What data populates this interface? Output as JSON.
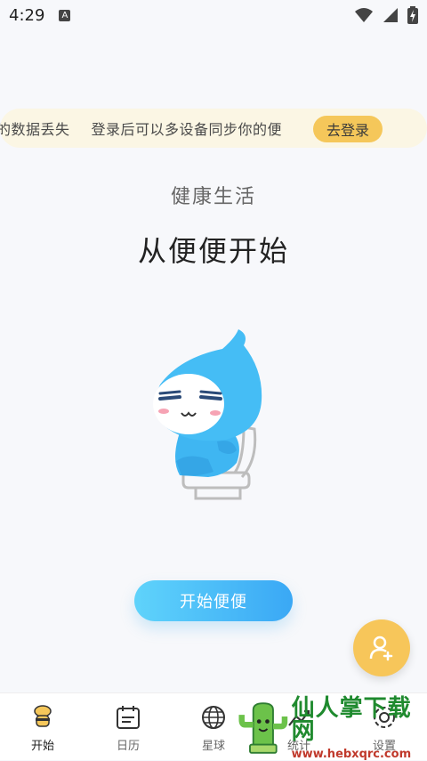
{
  "status_bar": {
    "time": "4:29",
    "badge": "A"
  },
  "banner": {
    "marquee_text_1": "的数据丢失",
    "marquee_text_2": "登录后可以多设备同步你的便",
    "login_label": "去登录"
  },
  "main": {
    "subtitle": "健康生活",
    "title": "从便便开始",
    "start_label": "开始便便"
  },
  "tabs": [
    {
      "label": "开始",
      "icon": "toilet-icon",
      "active": true
    },
    {
      "label": "日历",
      "icon": "calendar-icon",
      "active": false
    },
    {
      "label": "星球",
      "icon": "globe-icon",
      "active": false
    },
    {
      "label": "",
      "icon": "download-icon",
      "active": false
    },
    {
      "label": "统计",
      "icon": "chart-icon",
      "active": false
    },
    {
      "label": "设置",
      "icon": "gear-icon",
      "active": false
    }
  ],
  "watermark": {
    "title": "仙人掌下载网",
    "url": "www.hebxqrc.com"
  },
  "colors": {
    "accent_blue": "#3aa8f5",
    "accent_yellow": "#f5c75a",
    "banner_bg": "#fbf6e4"
  }
}
